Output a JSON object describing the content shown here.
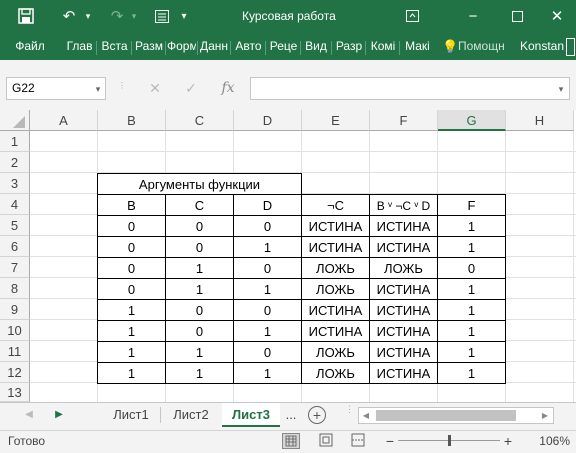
{
  "window": {
    "title": "Курсовая работа Агеев…"
  },
  "ribbon": {
    "tabs": [
      "Файл",
      "Глав",
      "Вста",
      "Разм",
      "Форм",
      "Данн",
      "Авто",
      "Реце",
      "Вид",
      "Разр",
      "Комі",
      "Макі"
    ],
    "search": "Помощн",
    "user": "Konstan"
  },
  "formula_bar": {
    "name_box": "G22",
    "fx": "fx",
    "formula": ""
  },
  "grid": {
    "columns": [
      "A",
      "B",
      "C",
      "D",
      "E",
      "F",
      "G",
      "H"
    ],
    "selected_column": "G",
    "rows": [
      "1",
      "2",
      "3",
      "4",
      "5",
      "6",
      "7",
      "8",
      "9",
      "10",
      "11",
      "12",
      "13"
    ]
  },
  "table": {
    "title": "Аргументы функции",
    "headers": [
      "B",
      "C",
      "D",
      "¬C",
      "B ᵛ ¬C ᵛ D",
      "F"
    ],
    "rows": [
      [
        "0",
        "0",
        "0",
        "ИСТИНА",
        "ИСТИНА",
        "1"
      ],
      [
        "0",
        "0",
        "1",
        "ИСТИНА",
        "ИСТИНА",
        "1"
      ],
      [
        "0",
        "1",
        "0",
        "ЛОЖЬ",
        "ЛОЖЬ",
        "0"
      ],
      [
        "0",
        "1",
        "1",
        "ЛОЖЬ",
        "ИСТИНА",
        "1"
      ],
      [
        "1",
        "0",
        "0",
        "ИСТИНА",
        "ИСТИНА",
        "1"
      ],
      [
        "1",
        "0",
        "1",
        "ИСТИНА",
        "ИСТИНА",
        "1"
      ],
      [
        "1",
        "1",
        "0",
        "ЛОЖЬ",
        "ИСТИНА",
        "1"
      ],
      [
        "1",
        "1",
        "1",
        "ЛОЖЬ",
        "ИСТИНА",
        "1"
      ]
    ]
  },
  "sheets": {
    "tabs": [
      "Лист1",
      "Лист2",
      "Лист3"
    ],
    "active": "Лист3",
    "more": "...",
    "add": "+"
  },
  "status": {
    "ready": "Готово",
    "zoom": "106%"
  },
  "colors": {
    "excel_green": "#217346"
  }
}
